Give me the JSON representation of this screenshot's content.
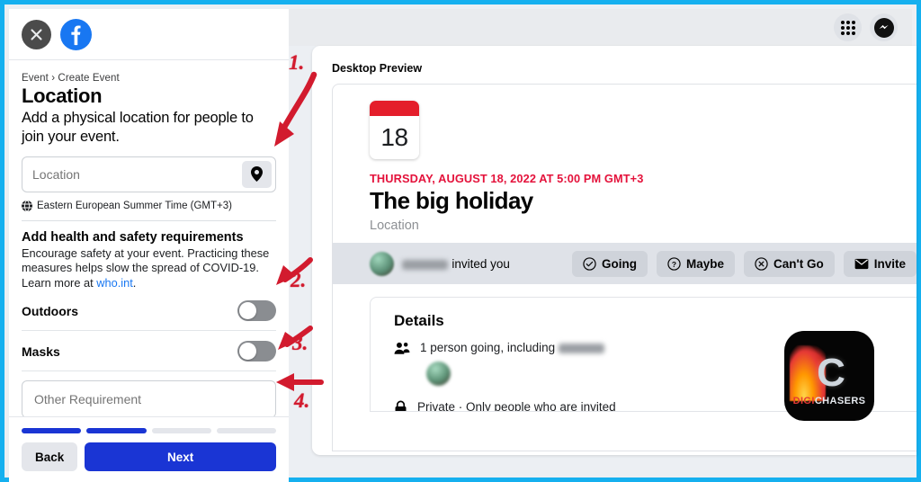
{
  "window": {
    "border_color": "#15b0ef",
    "accent_blue": "#1a35d4",
    "fb_blue": "#1877f2",
    "event_red": "#e4123b"
  },
  "left_dialog": {
    "close_icon": "close-icon",
    "brand_icon": "facebook-logo",
    "breadcrumb": "Event › Create Event",
    "title": "Location",
    "subtitle": "Add a physical location for people to join your event.",
    "location_input": {
      "value": "",
      "placeholder": "Location",
      "button_icon": "map-pin-icon"
    },
    "timezone": {
      "icon": "globe-icon",
      "text": "Eastern European Summer Time (GMT+3)"
    },
    "health": {
      "title": "Add health and safety requirements",
      "desc_part1": "Encourage safety at your event. Practicing these measures helps slow the spread of COVID-19. Learn more at ",
      "link": "who.int",
      "desc_part2": "."
    },
    "toggles": [
      {
        "label": "Outdoors",
        "state": "off"
      },
      {
        "label": "Masks",
        "state": "off"
      }
    ],
    "other_requirement": {
      "value": "",
      "placeholder": "Other Requirement"
    },
    "progress": {
      "total": 4,
      "completed": 2
    },
    "back_label": "Back",
    "next_label": "Next"
  },
  "top_bar": {
    "grid_icon": "apps-grid-icon",
    "messenger_icon": "messenger-icon"
  },
  "preview": {
    "label": "Desktop Preview",
    "calendar": {
      "day": "18",
      "header_color": "#e41e2b"
    },
    "date_line": "THURSDAY, AUGUST 18, 2022 AT 5:00 PM GMT+3",
    "event_title": "The big holiday",
    "location_placeholder": "Location",
    "inviter": {
      "name_redacted": "Redacted",
      "suffix": "invited you",
      "avatar": "user-avatar"
    },
    "rsvp_buttons": [
      {
        "label": "Going",
        "icon": "check-circle-icon"
      },
      {
        "label": "Maybe",
        "icon": "question-circle-icon"
      },
      {
        "label": "Can't Go",
        "icon": "x-circle-icon"
      },
      {
        "label": "Invite",
        "icon": "envelope-icon"
      }
    ],
    "details": {
      "title": "Details",
      "going_icon": "people-icon",
      "going_text": "1 person going, including",
      "going_name_redacted": "Redacted",
      "privacy_icon": "lock-icon",
      "privacy_text": "Private · Only people who are invited"
    }
  },
  "watermark": {
    "mark": "C",
    "name_a": "DIGI",
    "name_b": "CHASERS"
  },
  "annotations": [
    {
      "num": "1."
    },
    {
      "num": "2."
    },
    {
      "num": "3."
    },
    {
      "num": "4."
    }
  ]
}
